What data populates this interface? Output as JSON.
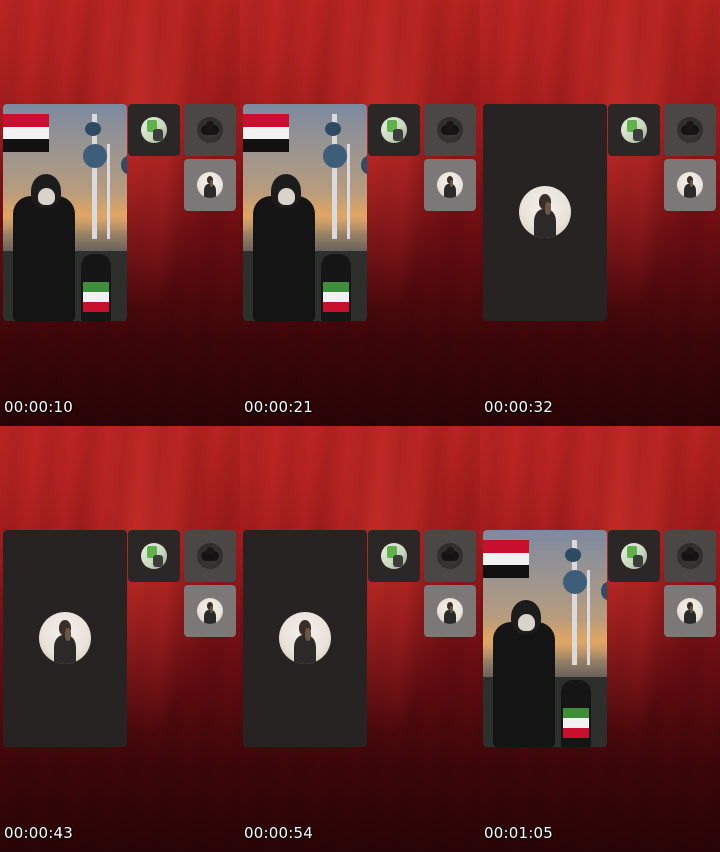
{
  "frames": [
    {
      "time": "00:00:10",
      "main": "video",
      "side_top_right": "gray"
    },
    {
      "time": "00:00:21",
      "main": "video",
      "side_top_right": "gray"
    },
    {
      "time": "00:00:32",
      "main": "avatar",
      "side_top_right": "gray"
    },
    {
      "time": "00:00:43",
      "main": "avatar",
      "side_top_right": "gray"
    },
    {
      "time": "00:00:54",
      "main": "avatar",
      "side_top_right": "gray"
    },
    {
      "time": "00:01:05",
      "main": "video",
      "side_top_right": "gray"
    }
  ],
  "icons": {
    "participant_1": "green-app-avatar-icon",
    "participant_2": "dark-group-avatar-icon",
    "participant_3": "man-portrait-avatar-icon"
  },
  "colors": {
    "background_red": "#9e1a1b",
    "empty_tile": "#262322",
    "tile_dark": "#2a2726",
    "tile_gray": "#4a4746",
    "tile_light": "#7b7877",
    "timestamp_text": "#ffffff"
  }
}
